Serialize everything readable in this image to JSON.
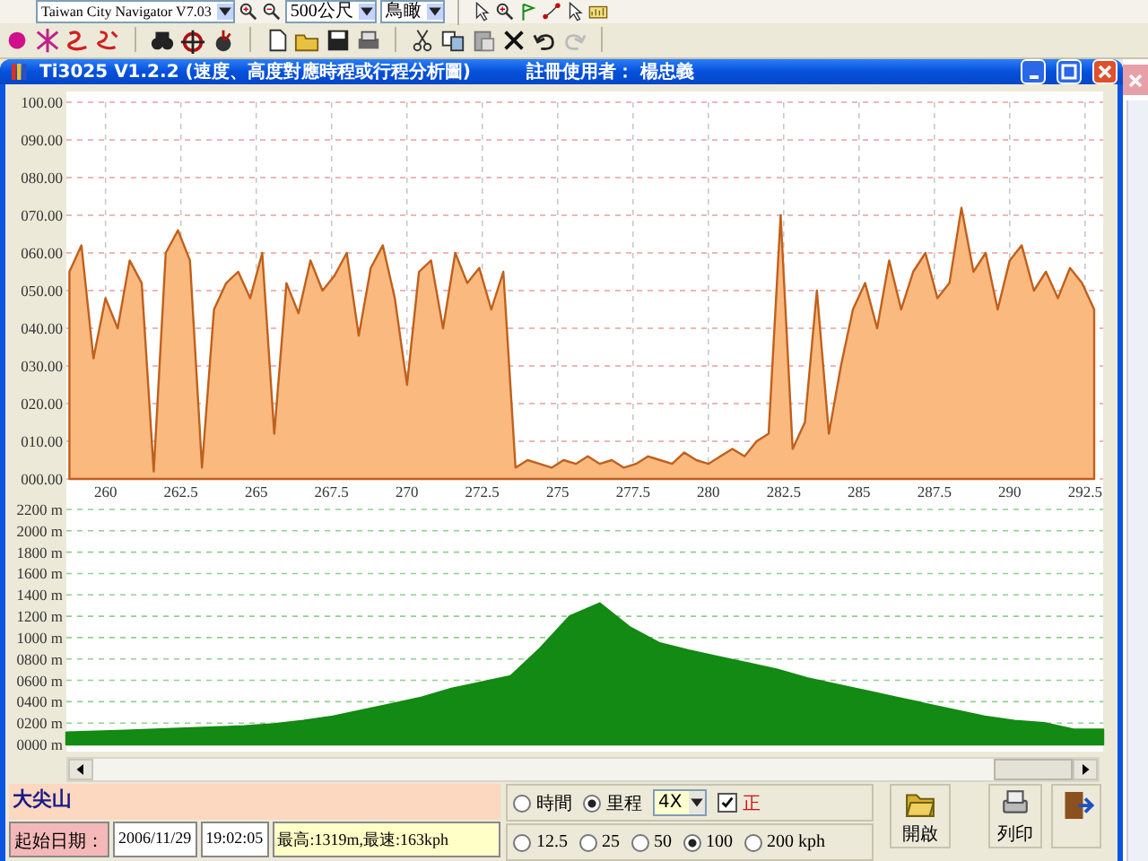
{
  "toolbar": {
    "combos": [
      {
        "value": "Taiwan City Navigator V7.03"
      },
      {
        "value": "500公尺"
      },
      {
        "value": "鳥瞰"
      }
    ]
  },
  "window": {
    "title": "Ti3025 V1.2.2 (速度、高度對應時程或行程分析圖)",
    "user": "註冊使用者： 楊忠義"
  },
  "speed_chart": {
    "chart_data": {
      "type": "area",
      "grid": true,
      "xlim": [
        258.7,
        293.1
      ],
      "ylim": [
        0,
        100
      ],
      "yticks": [
        {
          "value": 0,
          "label": "000.00"
        },
        {
          "value": 10,
          "label": "010.00"
        },
        {
          "value": 20,
          "label": "020.00"
        },
        {
          "value": 30,
          "label": "030.00"
        },
        {
          "value": 40,
          "label": "040.00"
        },
        {
          "value": 50,
          "label": "050.00"
        },
        {
          "value": 60,
          "label": "060.00"
        },
        {
          "value": 70,
          "label": "070.00"
        },
        {
          "value": 80,
          "label": "080.00"
        },
        {
          "value": 90,
          "label": "090.00"
        },
        {
          "value": 100,
          "label": "100.00"
        }
      ],
      "xticks": [
        260,
        262.5,
        265,
        267.5,
        270,
        272.5,
        275,
        277.5,
        280,
        282.5,
        285,
        287.5,
        290,
        292.5
      ],
      "x": [
        258.8,
        259.2,
        259.6,
        260.0,
        260.4,
        260.8,
        261.2,
        261.6,
        262.0,
        262.4,
        262.8,
        263.2,
        263.6,
        264.0,
        264.4,
        264.8,
        265.2,
        265.6,
        266.0,
        266.4,
        266.8,
        267.2,
        267.6,
        268.0,
        268.4,
        268.8,
        269.2,
        269.6,
        270.0,
        270.4,
        270.8,
        271.2,
        271.6,
        272.0,
        272.4,
        272.8,
        273.2,
        273.6,
        274.0,
        274.4,
        274.8,
        275.2,
        275.6,
        276.0,
        276.4,
        276.8,
        277.2,
        277.6,
        278.0,
        278.4,
        278.8,
        279.2,
        279.6,
        280.0,
        280.4,
        280.8,
        281.2,
        281.6,
        282.0,
        282.4,
        282.8,
        283.2,
        283.6,
        284.0,
        284.4,
        284.8,
        285.2,
        285.6,
        286.0,
        286.4,
        286.8,
        287.2,
        287.6,
        288.0,
        288.4,
        288.8,
        289.2,
        289.6,
        290.0,
        290.4,
        290.8,
        291.2,
        291.6,
        292.0,
        292.4,
        292.8
      ],
      "series": [
        {
          "color": "#f9b97f",
          "values": [
            55,
            62,
            32,
            48,
            40,
            58,
            52,
            2,
            60,
            66,
            58,
            3,
            45,
            52,
            55,
            48,
            60,
            12,
            52,
            44,
            58,
            50,
            54,
            60,
            38,
            56,
            62,
            48,
            25,
            55,
            58,
            40,
            60,
            52,
            56,
            45,
            55,
            3,
            5,
            4,
            3,
            5,
            4,
            6,
            4,
            5,
            3,
            4,
            6,
            5,
            4,
            7,
            5,
            4,
            6,
            8,
            6,
            10,
            12,
            70,
            8,
            15,
            50,
            12,
            30,
            45,
            52,
            40,
            58,
            45,
            55,
            60,
            48,
            52,
            72,
            55,
            60,
            45,
            58,
            62,
            50,
            55,
            48,
            56,
            52,
            45
          ]
        }
      ]
    }
  },
  "elevation_chart": {
    "chart_data": {
      "type": "area",
      "grid": true,
      "ylim": [
        0,
        2200
      ],
      "yticks": [
        {
          "value": 0,
          "label": "0000 m"
        },
        {
          "value": 200,
          "label": "0200 m"
        },
        {
          "value": 400,
          "label": "0400 m"
        },
        {
          "value": 600,
          "label": "0600 m"
        },
        {
          "value": 800,
          "label": "0800 m"
        },
        {
          "value": 1000,
          "label": "1000 m"
        },
        {
          "value": 1200,
          "label": "1200 m"
        },
        {
          "value": 1400,
          "label": "1400 m"
        },
        {
          "value": 1600,
          "label": "1600 m"
        },
        {
          "value": 1800,
          "label": "1800 m"
        },
        {
          "value": 2000,
          "label": "2000 m"
        },
        {
          "value": 2200,
          "label": "2200 m"
        }
      ],
      "series": [
        {
          "color": "#138a13",
          "values": [
            110,
            120,
            130,
            140,
            150,
            160,
            170,
            190,
            220,
            260,
            320,
            380,
            440,
            520,
            580,
            640,
            900,
            1200,
            1320,
            1100,
            950,
            880,
            820,
            760,
            700,
            620,
            560,
            500,
            440,
            380,
            320,
            260,
            220,
            200,
            140,
            140
          ]
        }
      ]
    }
  },
  "info": {
    "place": "大尖山",
    "date_label": "起始日期：",
    "date": "2006/11/29",
    "time": "19:02:05",
    "summary": "最高:1319m,最速:163kph"
  },
  "axis_mode": [
    {
      "label": "時間",
      "selected": false
    },
    {
      "label": "里程",
      "selected": true
    }
  ],
  "zoom": {
    "value": "4X"
  },
  "direction": {
    "label": "正",
    "checked": true
  },
  "speed_scale": [
    {
      "label": "12.5",
      "selected": false
    },
    {
      "label": "25",
      "selected": false
    },
    {
      "label": "50",
      "selected": false
    },
    {
      "label": "100",
      "selected": true
    },
    {
      "label": "200 kph",
      "selected": false
    }
  ],
  "buttons": [
    {
      "kind": "open",
      "label": "開啟"
    },
    {
      "kind": "print",
      "label": "列印"
    },
    {
      "kind": "exit"
    }
  ]
}
